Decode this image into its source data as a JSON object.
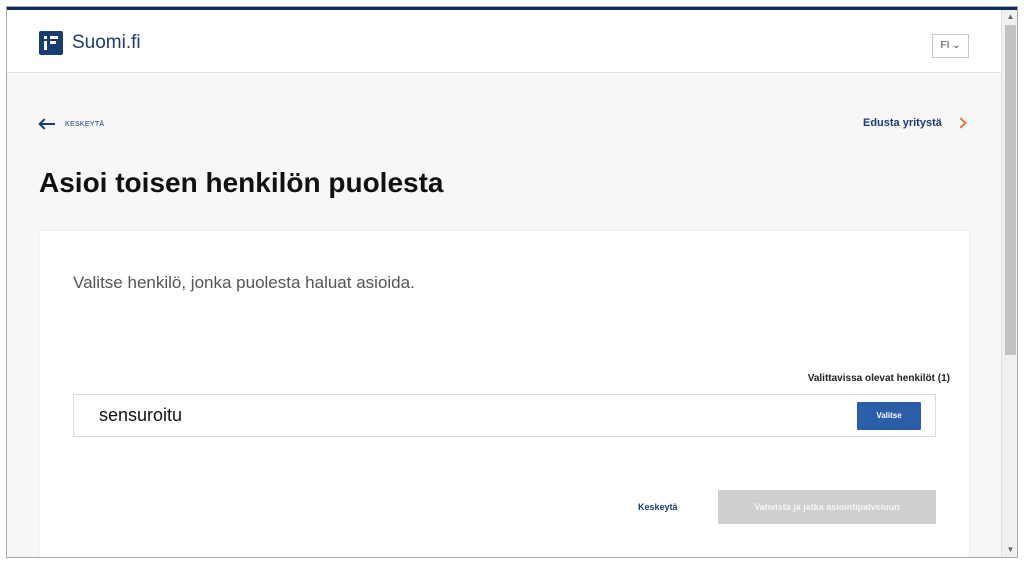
{
  "header": {
    "logo_text": "Suomi.fi",
    "language": "FI"
  },
  "nav": {
    "back_label": "KESKEYTÄ",
    "represent_company": "Edusta yritystä"
  },
  "page": {
    "title": "Asioi toisen henkilön puolesta"
  },
  "card": {
    "instruction": "Valitse henkilö, jonka puolesta haluat asioida.",
    "list_heading": "Valittavissa olevat henkilöt (1)",
    "persons": [
      {
        "name": "sensuroitu",
        "select_label": "Valitse"
      }
    ],
    "cancel_label": "Keskeytä",
    "confirm_label": "Vahvista ja jatka asiointipalveluun"
  },
  "icons": {
    "logo": "suomi-fi-logo-icon",
    "language_dropdown": "chevron-down-icon",
    "back": "arrow-left-icon",
    "forward": "chevron-right-icon"
  },
  "colors": {
    "brand": "#1a3c74",
    "primary_button": "#2a5ea8",
    "accent_chevron": "#e7782a",
    "disabled_button": "#cfcfcf"
  }
}
